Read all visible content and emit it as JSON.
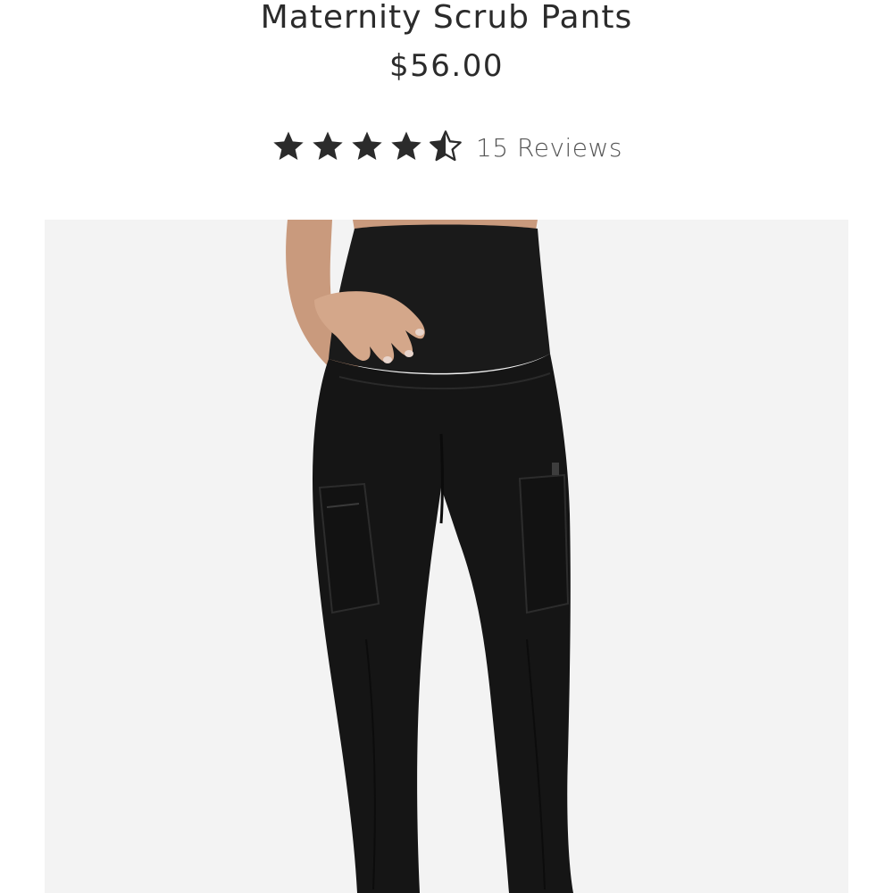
{
  "product": {
    "title": "Maternity Scrub Pants",
    "price": "$56.00"
  },
  "rating": {
    "value": 4.5,
    "max": 5,
    "reviews_label": "15 Reviews",
    "star_icons": [
      "star-full-icon",
      "star-full-icon",
      "star-full-icon",
      "star-full-icon",
      "star-half-icon"
    ]
  },
  "image": {
    "subject": "black maternity scrub pants worn by model",
    "colors": {
      "background": "#f3f3f3",
      "garment": "#151515",
      "skin": "#c99a7d"
    }
  },
  "colors": {
    "text": "#2b2b2b",
    "review_text": "#555555",
    "star": "#2b2b2b"
  }
}
